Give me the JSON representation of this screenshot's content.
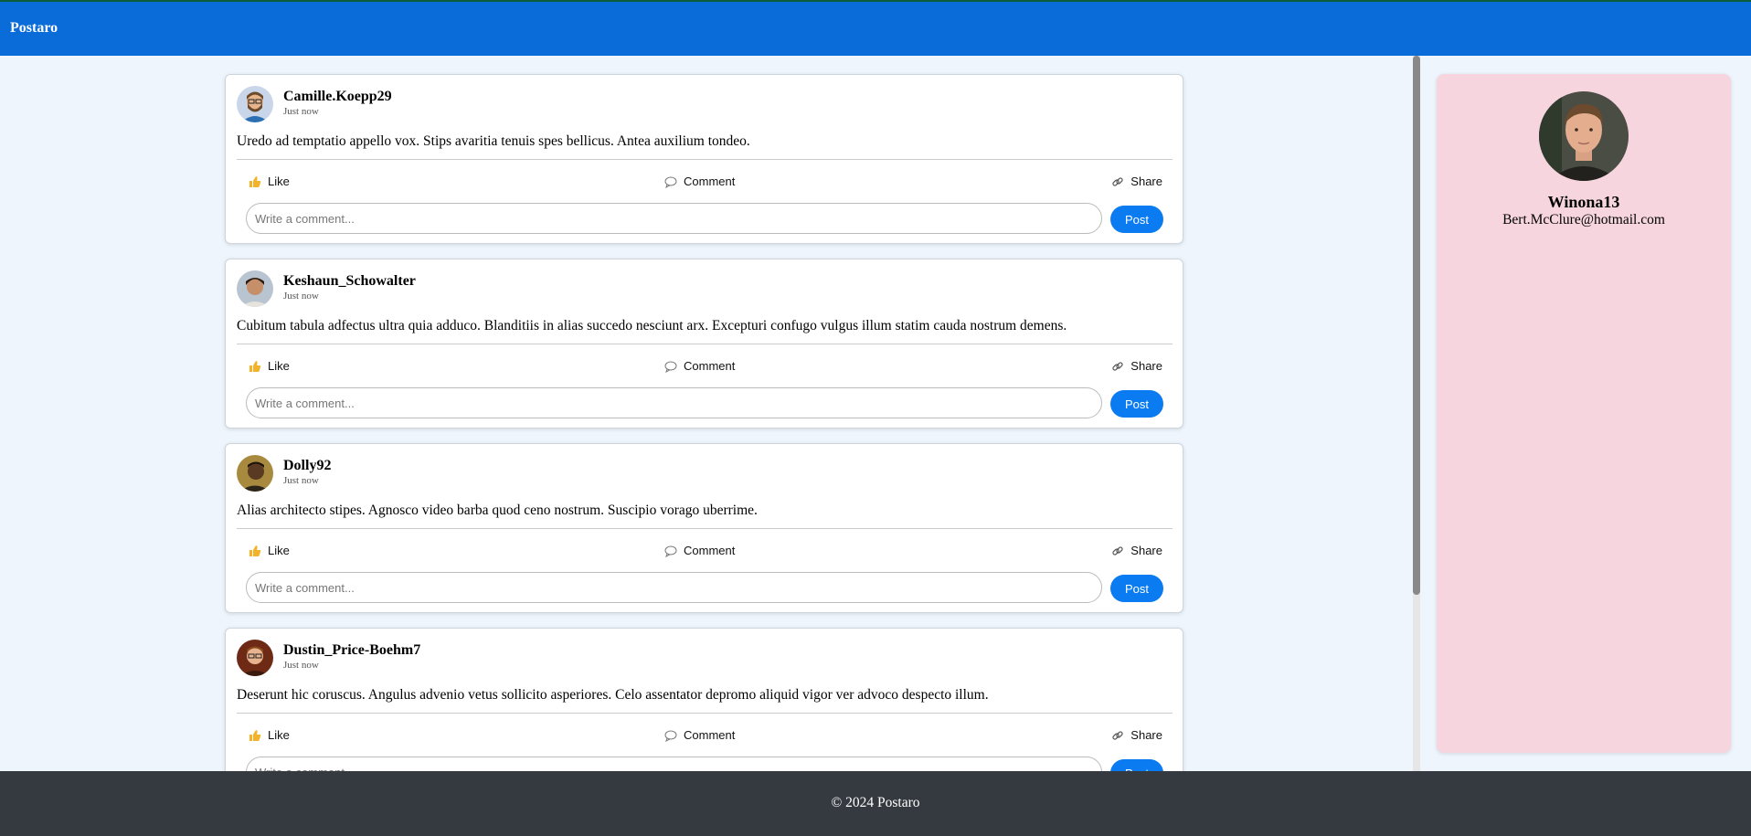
{
  "app": {
    "brand": "Postaro"
  },
  "posts": [
    {
      "username": "Camille.Koepp29",
      "time": "Just now",
      "content": "Uredo ad temptatio appello vox. Stips avaritia tenuis spes bellicus. Antea auxilium tondeo.",
      "like_label": "Like",
      "comment_label": "Comment",
      "share_label": "Share",
      "comment_placeholder": "Write a comment...",
      "post_label": "Post"
    },
    {
      "username": "Keshaun_Schowalter",
      "time": "Just now",
      "content": "Cubitum tabula adfectus ultra quia adduco. Blanditiis in alias succedo nesciunt arx. Excepturi confugo vulgus illum statim cauda nostrum demens.",
      "like_label": "Like",
      "comment_label": "Comment",
      "share_label": "Share",
      "comment_placeholder": "Write a comment...",
      "post_label": "Post"
    },
    {
      "username": "Dolly92",
      "time": "Just now",
      "content": "Alias architecto stipes. Agnosco video barba quod ceno nostrum. Suscipio vorago uberrime.",
      "like_label": "Like",
      "comment_label": "Comment",
      "share_label": "Share",
      "comment_placeholder": "Write a comment...",
      "post_label": "Post"
    },
    {
      "username": "Dustin_Price-Boehm7",
      "time": "Just now",
      "content": "Deserunt hic coruscus. Angulus advenio vetus sollicito asperiores. Celo assentator depromo aliquid vigor ver advoco despecto illum.",
      "like_label": "Like",
      "comment_label": "Comment",
      "share_label": "Share",
      "comment_placeholder": "Write a comment...",
      "post_label": "Post"
    }
  ],
  "profile": {
    "name": "Winona13",
    "email": "Bert.McClure@hotmail.com"
  },
  "footer": {
    "text": "© 2024 Postaro"
  },
  "colors": {
    "header": "#0a6cd8",
    "post_button": "#0a7bf0",
    "profile_card": "#f6d5de",
    "footer": "#343a40"
  }
}
